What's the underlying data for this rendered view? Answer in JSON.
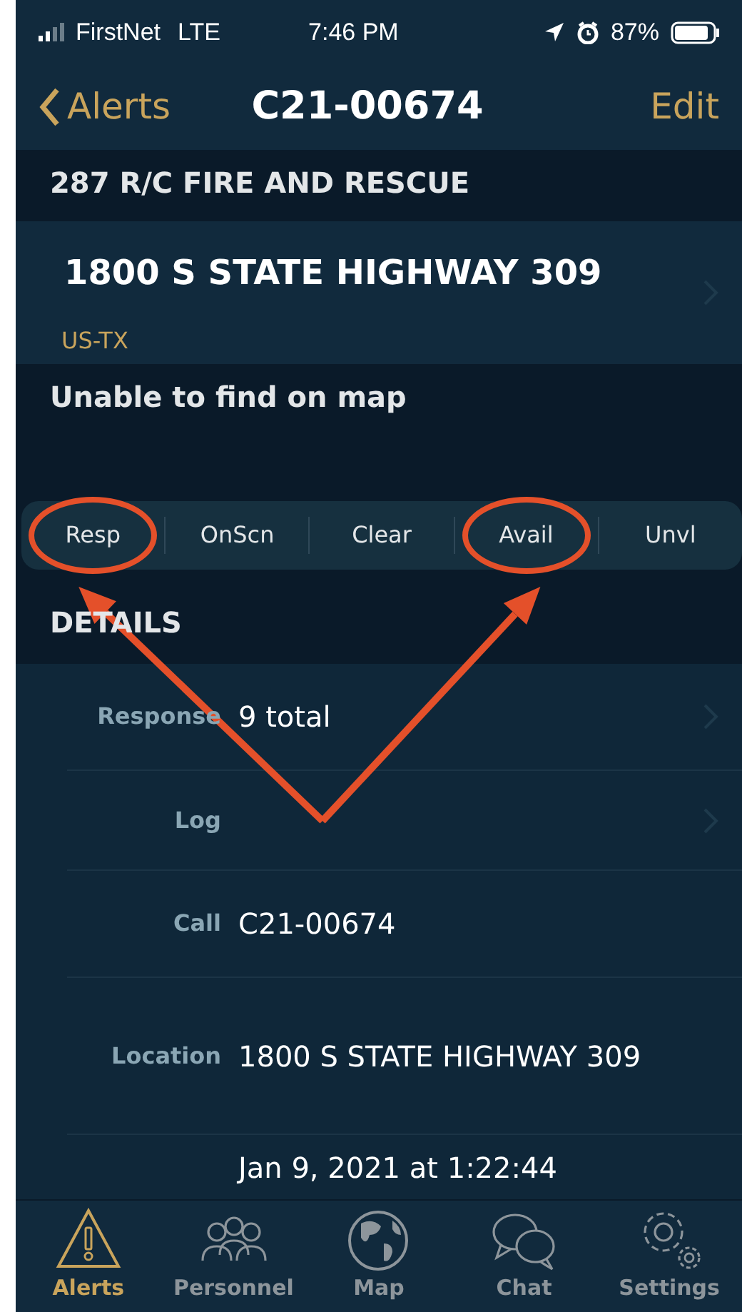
{
  "status_bar": {
    "carrier": "FirstNet",
    "network": "LTE",
    "time": "7:46 PM",
    "battery": "87%"
  },
  "nav": {
    "back": "Alerts",
    "title": "C21-00674",
    "action": "Edit"
  },
  "agency": "287 R/C FIRE AND RESCUE",
  "address": {
    "street": "1800 S STATE HIGHWAY 309",
    "region": "US-TX"
  },
  "map_notice": "Unable to find on map",
  "status_buttons": [
    {
      "label": "Resp",
      "circled": true
    },
    {
      "label": "OnScn",
      "circled": false
    },
    {
      "label": "Clear",
      "circled": false
    },
    {
      "label": "Avail",
      "circled": true
    },
    {
      "label": "Unvl",
      "circled": false
    }
  ],
  "details": {
    "title": "DETAILS",
    "rows": [
      {
        "label": "Response",
        "value": "9 total",
        "chevron": true
      },
      {
        "label": "Log",
        "chevron": true
      },
      {
        "label": "Call",
        "value": "C21-00674",
        "chevron": false
      },
      {
        "label": "Location",
        "value": "1800 S STATE HIGHWAY 309",
        "chevron": false
      },
      {
        "value": "Jan 9, 2021 at 1:22:44",
        "chevron": false
      }
    ]
  },
  "tabs": [
    {
      "label": "Alerts",
      "kind": "warning",
      "selected": true
    },
    {
      "label": "Personnel",
      "kind": "people",
      "selected": false
    },
    {
      "label": "Map",
      "kind": "globe",
      "selected": false
    },
    {
      "label": "Chat",
      "kind": "chat",
      "selected": false
    },
    {
      "label": "Settings",
      "kind": "gear",
      "selected": false
    }
  ]
}
